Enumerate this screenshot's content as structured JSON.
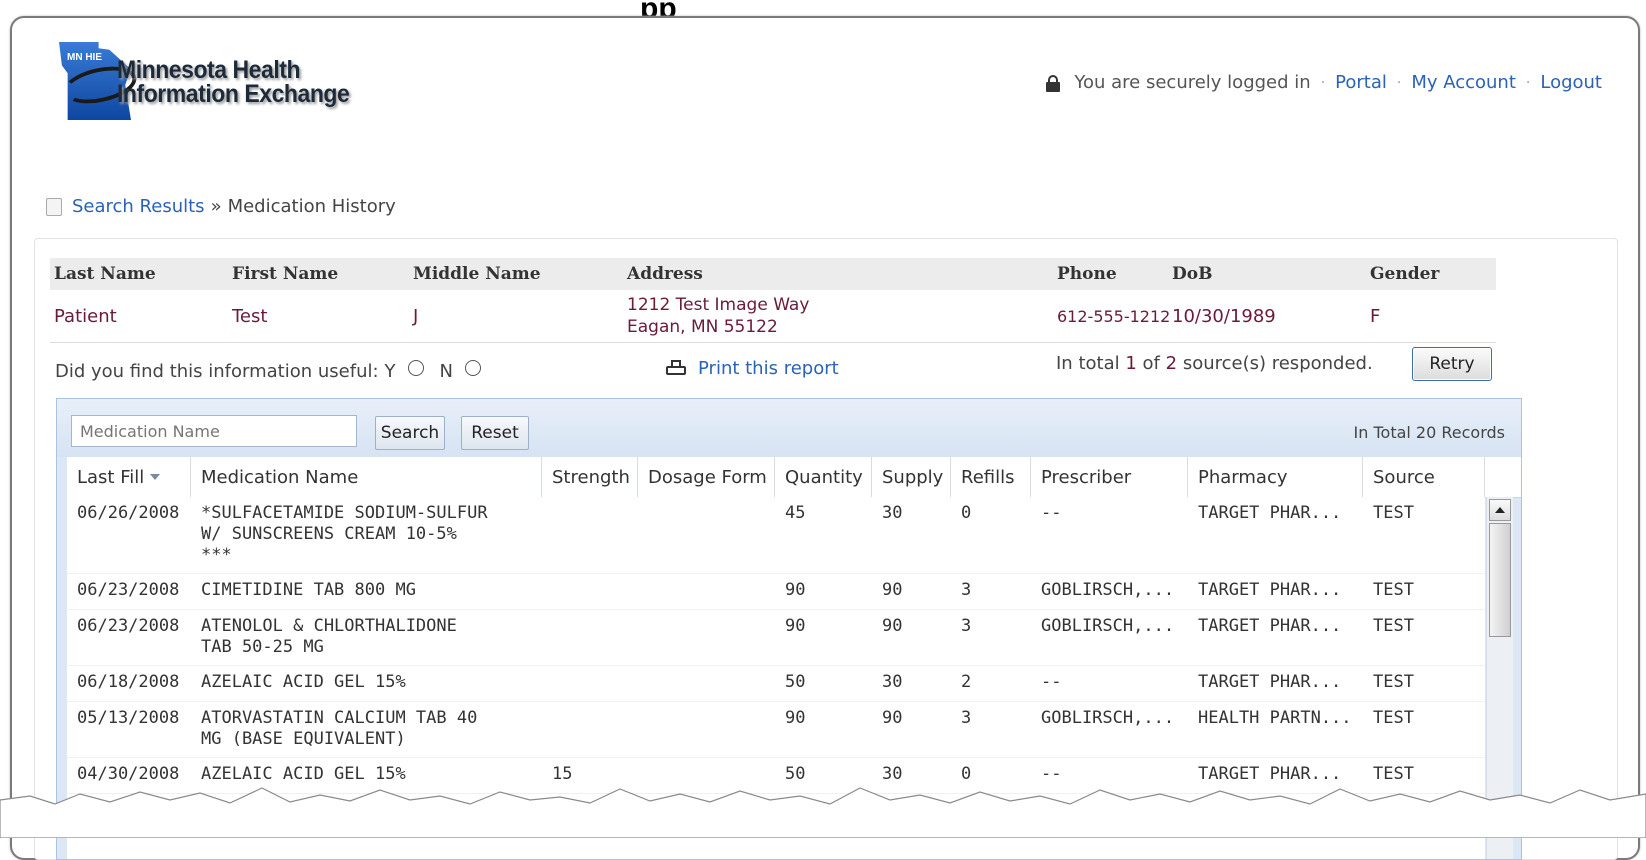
{
  "logo": {
    "badge": "MN HIE",
    "line1": "Minnesota Health",
    "line2": "Information Exchange"
  },
  "topnav": {
    "status": "You are securely logged in",
    "links": [
      "Portal",
      "My Account",
      "Logout"
    ]
  },
  "breadcrumb": {
    "link": "Search Results",
    "separator": "»",
    "current": "Medication History"
  },
  "patient": {
    "headers": [
      "Last Name",
      "First Name",
      "Middle Name",
      "Address",
      "Phone",
      "DoB",
      "Gender"
    ],
    "last": "Patient",
    "first": "Test",
    "middle": "J",
    "address1": "1212 Test Image Way",
    "address2": "Eagan, MN 55122",
    "phone": "612-555-1212",
    "dob": "10/30/1989",
    "gender": "F"
  },
  "feedback": {
    "question": "Did you find this information useful:",
    "yes": "Y",
    "no": "N"
  },
  "print": {
    "label": "Print this report"
  },
  "sources": {
    "prefix": "In total",
    "responded": "1",
    "of": "of",
    "total": "2",
    "suffix": "source(s) responded."
  },
  "retry": {
    "label": "Retry"
  },
  "grid": {
    "search_placeholder": "Medication Name",
    "search_label": "Search",
    "reset_label": "Reset",
    "total_label": "In Total 20 Records",
    "columns": [
      "Last Fill",
      "Medication Name",
      "Strength",
      "Dosage Form",
      "Quantity",
      "Supply",
      "Refills",
      "Prescriber",
      "Pharmacy",
      "Source"
    ],
    "rows": [
      {
        "fill": "06/26/2008",
        "name": "*SULFACETAMIDE SODIUM-SULFUR\nW/ SUNSCREENS CREAM 10-5%\n***",
        "strength": "",
        "form": "",
        "qty": "45",
        "supply": "30",
        "refills": "0",
        "prescriber": "--",
        "pharmacy": "TARGET PHAR...",
        "source": "TEST"
      },
      {
        "fill": "06/23/2008",
        "name": "CIMETIDINE TAB 800 MG",
        "strength": "",
        "form": "",
        "qty": "90",
        "supply": "90",
        "refills": "3",
        "prescriber": "GOBLIRSCH,...",
        "pharmacy": "TARGET PHAR...",
        "source": "TEST"
      },
      {
        "fill": "06/23/2008",
        "name": "ATENOLOL & CHLORTHALIDONE\nTAB 50-25 MG",
        "strength": "",
        "form": "",
        "qty": "90",
        "supply": "90",
        "refills": "3",
        "prescriber": "GOBLIRSCH,...",
        "pharmacy": "TARGET PHAR...",
        "source": "TEST"
      },
      {
        "fill": "06/18/2008",
        "name": "AZELAIC ACID GEL 15%",
        "strength": "",
        "form": "",
        "qty": "50",
        "supply": "30",
        "refills": "2",
        "prescriber": "--",
        "pharmacy": "TARGET PHAR...",
        "source": "TEST"
      },
      {
        "fill": "05/13/2008",
        "name": "ATORVASTATIN CALCIUM TAB 40\nMG (BASE EQUIVALENT)",
        "strength": "",
        "form": "",
        "qty": "90",
        "supply": "90",
        "refills": "3",
        "prescriber": "GOBLIRSCH,...",
        "pharmacy": "HEALTH PARTN...",
        "source": "TEST"
      },
      {
        "fill": "04/30/2008",
        "name": "AZELAIC ACID GEL 15%",
        "strength": "15",
        "form": "",
        "qty": "50",
        "supply": "30",
        "refills": "0",
        "prescriber": "--",
        "pharmacy": "TARGET PHAR...",
        "source": "TEST"
      }
    ]
  },
  "colors": {
    "link": "#2a62b8",
    "patient_value": "#6b1a3a",
    "grid_border": "#a9c3e3"
  }
}
